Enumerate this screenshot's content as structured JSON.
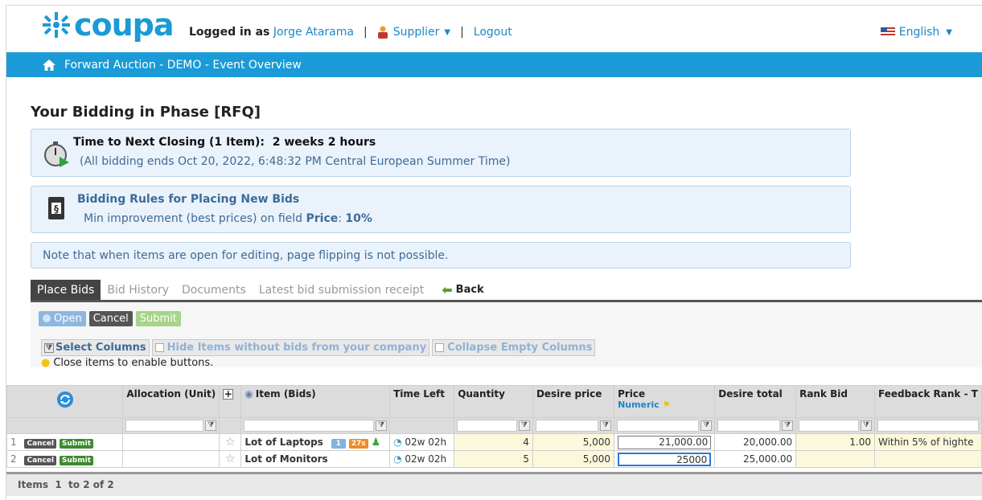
{
  "brand": {
    "name": "coupa"
  },
  "topbar": {
    "logged_in_label": "Logged in as",
    "user_name": "Jorge Atarama",
    "role": "Supplier",
    "logout": "Logout",
    "language": "English"
  },
  "nav": {
    "breadcrumb": "Forward Auction - DEMO - Event Overview"
  },
  "page": {
    "title": "Your Bidding in Phase [RFQ]"
  },
  "closing": {
    "title": "Time to Next Closing (1 Item):",
    "value": "2 weeks 2 hours",
    "subtitle": "(All bidding ends Oct 20, 2022, 6:48:32 PM Central European Summer Time)"
  },
  "rules": {
    "title": "Bidding Rules for Placing New Bids",
    "text_prefix": "Min improvement (best prices) on field",
    "field": "Price",
    "value": "10%"
  },
  "note": "Note that when items are open for editing, page flipping is not possible.",
  "tabs": [
    {
      "label": "Place Bids"
    },
    {
      "label": "Bid History"
    },
    {
      "label": "Documents"
    },
    {
      "label": "Latest bid submission receipt"
    },
    {
      "label": "Back"
    }
  ],
  "toolbar": {
    "open": "Open",
    "cancel": "Cancel",
    "submit": "Submit"
  },
  "filters": {
    "select_columns": "Select Columns",
    "hide_items": "Hide Items without bids from your company",
    "collapse": "Collapse Empty Columns",
    "hint": "Close items to enable buttons."
  },
  "table": {
    "headers": {
      "allocation": "Allocation (Unit)",
      "plus": "+",
      "item": "Item (Bids)",
      "time_left": "Time Left",
      "quantity": "Quantity",
      "desire_price": "Desire price",
      "price": "Price",
      "price_sub": "Numeric",
      "desire_total": "Desire total",
      "rank_bid": "Rank Bid",
      "feedback": "Feedback Rank - T"
    },
    "rows": [
      {
        "index": "1",
        "cancel": "Cancel",
        "submit": "Submit",
        "item": "Lot of Laptops",
        "badge1": "1",
        "badge2": "27s",
        "time": "02w 02h",
        "quantity": "4",
        "desire_price": "5,000",
        "price": "21,000.00",
        "desire_total": "20,000.00",
        "rank_bid": "1.00",
        "feedback": "Within 5% of highte"
      },
      {
        "index": "2",
        "cancel": "Cancel",
        "submit": "Submit",
        "item": "Lot of Monitors",
        "time": "02w 02h",
        "quantity": "5",
        "desire_price": "5,000",
        "price": "25000",
        "desire_total": "25,000.00",
        "rank_bid": "",
        "feedback": ""
      }
    ]
  },
  "footer": {
    "items": "Items  1  to 2 of 2"
  }
}
